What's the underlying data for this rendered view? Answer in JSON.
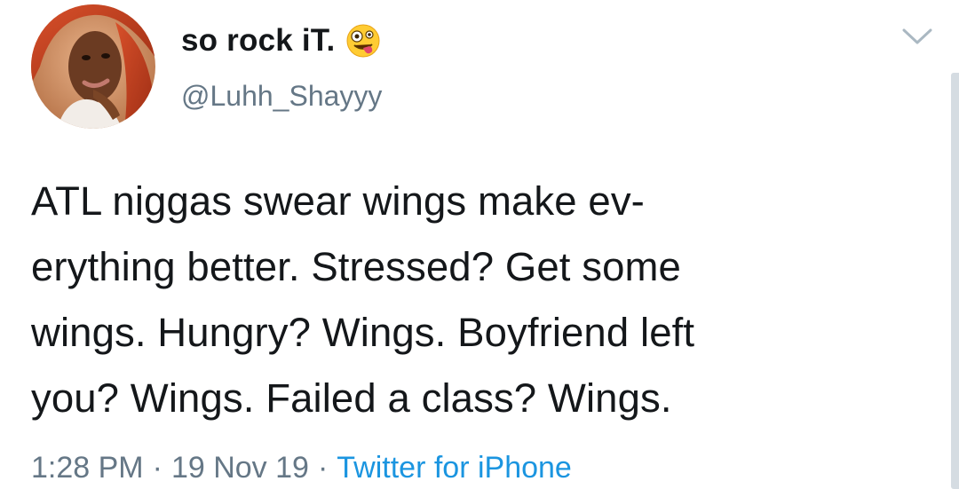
{
  "tweet": {
    "display_name": "so rock iT.",
    "emoji_icon": "zany-face-emoji",
    "handle": "@Luhh_Shayyy",
    "text_lines": [
      "ATL niggas swear wings make ev-",
      "erything better. Stressed? Get some",
      "wings. Hungry? Wings. Boyfriend left",
      "you? Wings. Failed a class? Wings."
    ],
    "time": "1:28 PM",
    "date": "19 Nov 19",
    "separator": "·",
    "source": "Twitter for iPhone"
  },
  "colors": {
    "text": "#14171a",
    "secondary": "#657786",
    "link": "#1b95e0",
    "scrollbar": "#d5dce2"
  }
}
